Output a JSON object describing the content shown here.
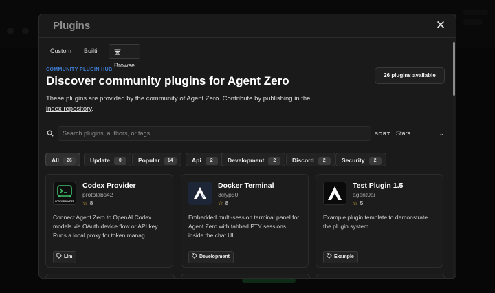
{
  "modal": {
    "title": "Plugins",
    "close_label": "✕",
    "tabs": [
      {
        "label": "Custom"
      },
      {
        "label": "Builtin"
      },
      {
        "label": "Browse"
      }
    ]
  },
  "hub": {
    "eyebrow": "COMMUNITY PLUGIN HUB",
    "title": "Discover community plugins for Agent Zero",
    "desc_prefix": "These plugins are provided by the community of Agent Zero. Contribute by publishing in the ",
    "desc_link": "index repository",
    "desc_suffix": ".",
    "count_label": "26 plugins available"
  },
  "search": {
    "placeholder": "Search plugins, authors, or tags...",
    "sort_label": "SORT",
    "sort_value": "Stars"
  },
  "filters": [
    {
      "label": "All",
      "count": "26"
    },
    {
      "label": "Update",
      "count": "0"
    },
    {
      "label": "Popular",
      "count": "14"
    },
    {
      "label": "Api",
      "count": "2"
    },
    {
      "label": "Development",
      "count": "2"
    },
    {
      "label": "Discord",
      "count": "2"
    },
    {
      "label": "Security",
      "count": "2"
    }
  ],
  "cards": [
    {
      "name": "Codex Provider",
      "author": "protolabs42",
      "stars": "8",
      "desc": "Connect Agent Zero to OpenAI Codex models via OAuth device flow or API key. Runs a local proxy for token manag...",
      "tag": "Llm",
      "logo_caption": "CODEX PROVIDER"
    },
    {
      "name": "Docker Terminal",
      "author": "3clyp50",
      "stars": "8",
      "desc": "Embedded multi-session terminal panel for Agent Zero with tabbed PTY sessions inside the chat UI.",
      "tag": "Development"
    },
    {
      "name": "Test Plugin 1.5",
      "author": "agent0ai",
      "stars": "5",
      "desc": "Example plugin template to demonstrate the plugin system",
      "tag": "Example"
    }
  ],
  "colors": {
    "accent_blue": "#3f7fd6",
    "star": "#f3c04a",
    "codex_green": "#3fbf6a"
  }
}
